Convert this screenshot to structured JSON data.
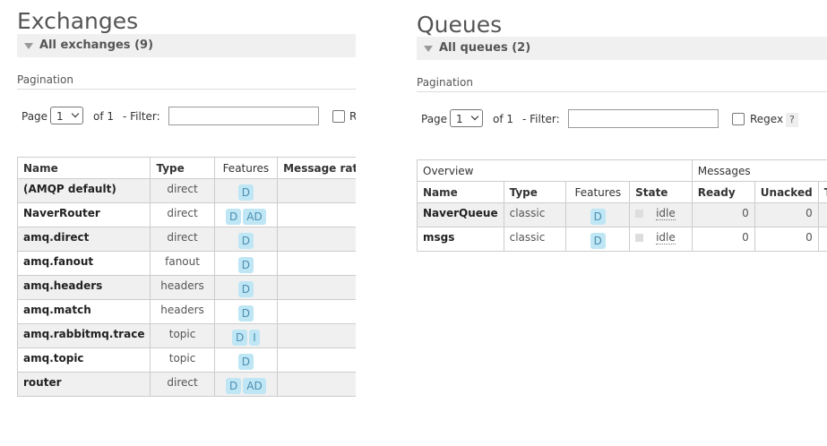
{
  "exchanges": {
    "title": "Exchanges",
    "section_label": "All exchanges (9)",
    "pagination_label": "Pagination",
    "page_label": "Page",
    "page_value": "1",
    "of_label": "of 1",
    "filter_label": "- Filter:",
    "filter_value": "",
    "regex_label": "R",
    "columns": [
      "Name",
      "Type",
      "Features",
      "Message rate"
    ],
    "rows": [
      {
        "name": "(AMQP default)",
        "type": "direct",
        "features": [
          "D"
        ]
      },
      {
        "name": "NaverRouter",
        "type": "direct",
        "features": [
          "D",
          "AD"
        ]
      },
      {
        "name": "amq.direct",
        "type": "direct",
        "features": [
          "D"
        ]
      },
      {
        "name": "amq.fanout",
        "type": "fanout",
        "features": [
          "D"
        ]
      },
      {
        "name": "amq.headers",
        "type": "headers",
        "features": [
          "D"
        ]
      },
      {
        "name": "amq.match",
        "type": "headers",
        "features": [
          "D"
        ]
      },
      {
        "name": "amq.rabbitmq.trace",
        "type": "topic",
        "features": [
          "D",
          "I"
        ]
      },
      {
        "name": "amq.topic",
        "type": "topic",
        "features": [
          "D"
        ]
      },
      {
        "name": "router",
        "type": "direct",
        "features": [
          "D",
          "AD"
        ]
      }
    ]
  },
  "queues": {
    "title": "Queues",
    "section_label": "All queues (2)",
    "pagination_label": "Pagination",
    "page_label": "Page",
    "page_value": "1",
    "of_label": "of 1",
    "filter_label": "- Filter:",
    "filter_value": "",
    "regex_label": "Regex",
    "help_label": "?",
    "group_headers": [
      "Overview",
      "Messages"
    ],
    "columns": [
      "Name",
      "Type",
      "Features",
      "State",
      "Ready",
      "Unacked",
      "T"
    ],
    "rows": [
      {
        "name": "NaverQueue",
        "type": "classic",
        "features": [
          "D"
        ],
        "state": "idle",
        "ready": "0",
        "unacked": "0"
      },
      {
        "name": "msgs",
        "type": "classic",
        "features": [
          "D"
        ],
        "state": "idle",
        "ready": "0",
        "unacked": "0"
      }
    ]
  }
}
